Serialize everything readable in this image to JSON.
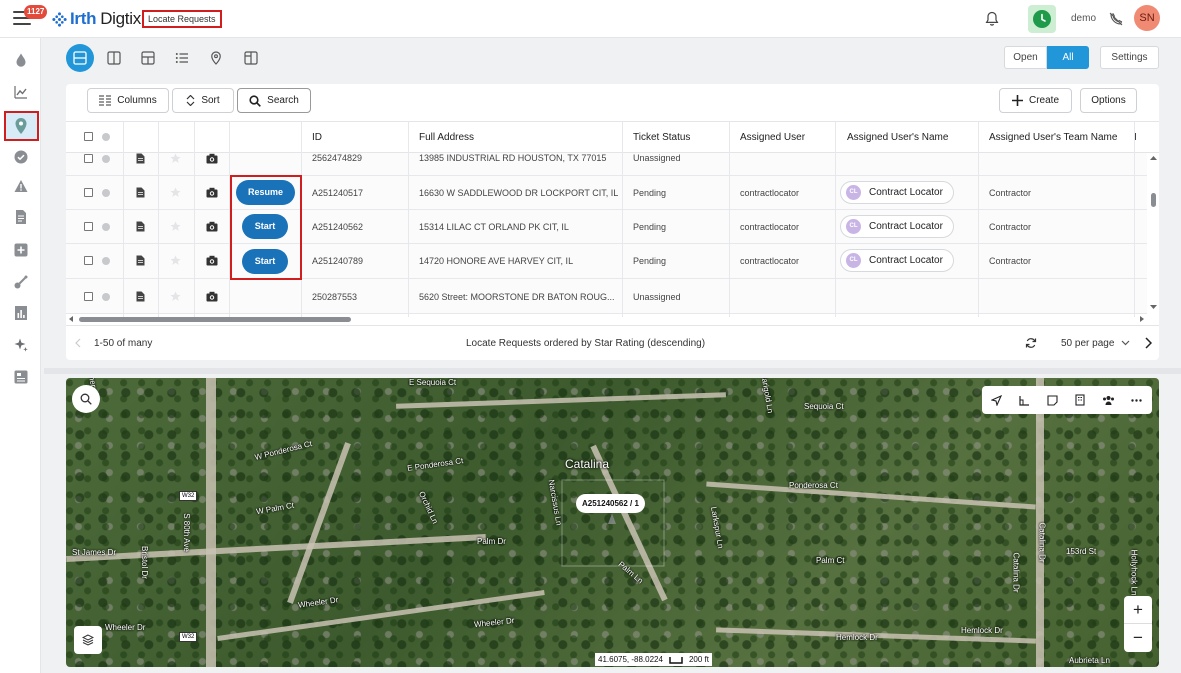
{
  "app": {
    "brand_bold": "Irth",
    "brand_rest": "Digtix",
    "notification_count": "1127",
    "page_title": "Locate Requests",
    "user_name": "demo",
    "user_initials": "SN"
  },
  "nav": [
    "drop-icon",
    "trend-icon",
    "location-pin-icon",
    "check-circle-icon",
    "warning-icon",
    "document-icon",
    "add-icon",
    "tools-icon",
    "report-icon",
    "sparkle-icon",
    "form-icon"
  ],
  "view_modes": [
    "list-view",
    "split-view",
    "grid-view",
    "list-bullets-view",
    "map-pin-view",
    "columns-view"
  ],
  "filter": {
    "open": "Open",
    "all": "All",
    "settings": "Settings"
  },
  "toolbar": {
    "columns": "Columns",
    "sort": "Sort",
    "search": "Search",
    "create": "Create",
    "options": "Options"
  },
  "table": {
    "headers": [
      "ID",
      "Full Address",
      "Ticket Status",
      "Assigned User",
      "Assigned User's Name",
      "Assigned User's Team Name",
      "I"
    ],
    "rows": [
      {
        "id": "2562474829",
        "address": "13985 INDUSTRIAL RD HOUSTON, TX 77015",
        "status": "Unassigned",
        "user": "",
        "name": "",
        "team": "",
        "action": ""
      },
      {
        "id": "A251240517",
        "address": "16630 W SADDLEWOOD DR LOCKPORT CIT, IL",
        "status": "Pending",
        "user": "contractlocator",
        "name": "Contract Locator",
        "team": "Contractor",
        "action": "Resume"
      },
      {
        "id": "A251240562",
        "address": "15314 LILAC CT ORLAND PK CIT, IL",
        "status": "Pending",
        "user": "contractlocator",
        "name": "Contract Locator",
        "team": "Contractor",
        "action": "Start"
      },
      {
        "id": "A251240789",
        "address": "14720 HONORE AVE HARVEY CIT, IL",
        "status": "Pending",
        "user": "contractlocator",
        "name": "Contract Locator",
        "team": "Contractor",
        "action": "Start"
      },
      {
        "id": "250287553",
        "address": "5620 Street: MOORSTONE DR BATON ROUG...",
        "status": "Unassigned",
        "user": "",
        "name": "",
        "team": "",
        "action": ""
      }
    ],
    "user_chip_initials": "CL"
  },
  "footer": {
    "range": "1-50 of many",
    "order": "Locate Requests ordered by Star Rating (descending)",
    "per_page": "50 per page"
  },
  "map": {
    "ticket_label": "A251240562 / 1",
    "place": "Catalina",
    "coords": "41.6075, -88.0224",
    "scale": "200 ft",
    "streets": [
      "E Sequoia Ct",
      "Sequoia Ct",
      "W Ponderosa Ct",
      "E Ponderosa Ct",
      "Ponderosa Ct",
      "Narcissus Ln",
      "W Palm Ct",
      "Palm Dr",
      "Palm Ln",
      "Palm Ct",
      "Orchid Ln",
      "Larkspur Ln",
      "Cherry Ln",
      "Marigold Ln",
      "St James Dr",
      "Bristol Dr",
      "Wheeler Dr",
      "Hemlock Dr",
      "Catalina Dr",
      "153rd St",
      "Aubrieta Ln",
      "S 80th Ave",
      "Wheeler Dr"
    ],
    "route_shield": "W32",
    "zoom_in": "+",
    "zoom_out": "−"
  }
}
